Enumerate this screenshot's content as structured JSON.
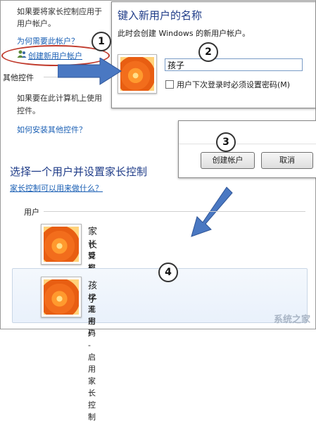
{
  "background": {
    "line1": "如果要将家长控制应用于",
    "line2": "用户帐户。",
    "why_link": "为何需要此帐户？",
    "create_link": "创建新用户帐户",
    "other_controls_heading": "其他控件",
    "other_line1": "如果要在此计算机上使用",
    "other_line2": "控件。",
    "install_link": "如何安装其他控件？"
  },
  "dialog": {
    "title": "键入新用户的名称",
    "subtitle": "此时会创建 Windows 的新用户帐户。",
    "name_value": "孩子",
    "checkbox_label": "用户下次登录时必须设置密码(M)"
  },
  "buttons": {
    "create": "创建帐户",
    "cancel": "取消"
  },
  "section": {
    "title": "选择一个用户并设置家长控制",
    "help_link": "家长控制可以用来做什么？",
    "users_label": "用户"
  },
  "users": [
    {
      "name": "家长",
      "line1": "计算机管理员",
      "line2": "受密码保护"
    },
    {
      "name": "孩子",
      "line1": "标准用户 - 启用家长控制",
      "line2": "无密码"
    }
  ],
  "markers": [
    "1",
    "2",
    "3",
    "4"
  ],
  "watermark": "系统之家",
  "colors": {
    "link": "#1a5fb4",
    "title": "#1f3c88",
    "arrow": "#4a78c2",
    "ellipse": "#c0392b"
  }
}
